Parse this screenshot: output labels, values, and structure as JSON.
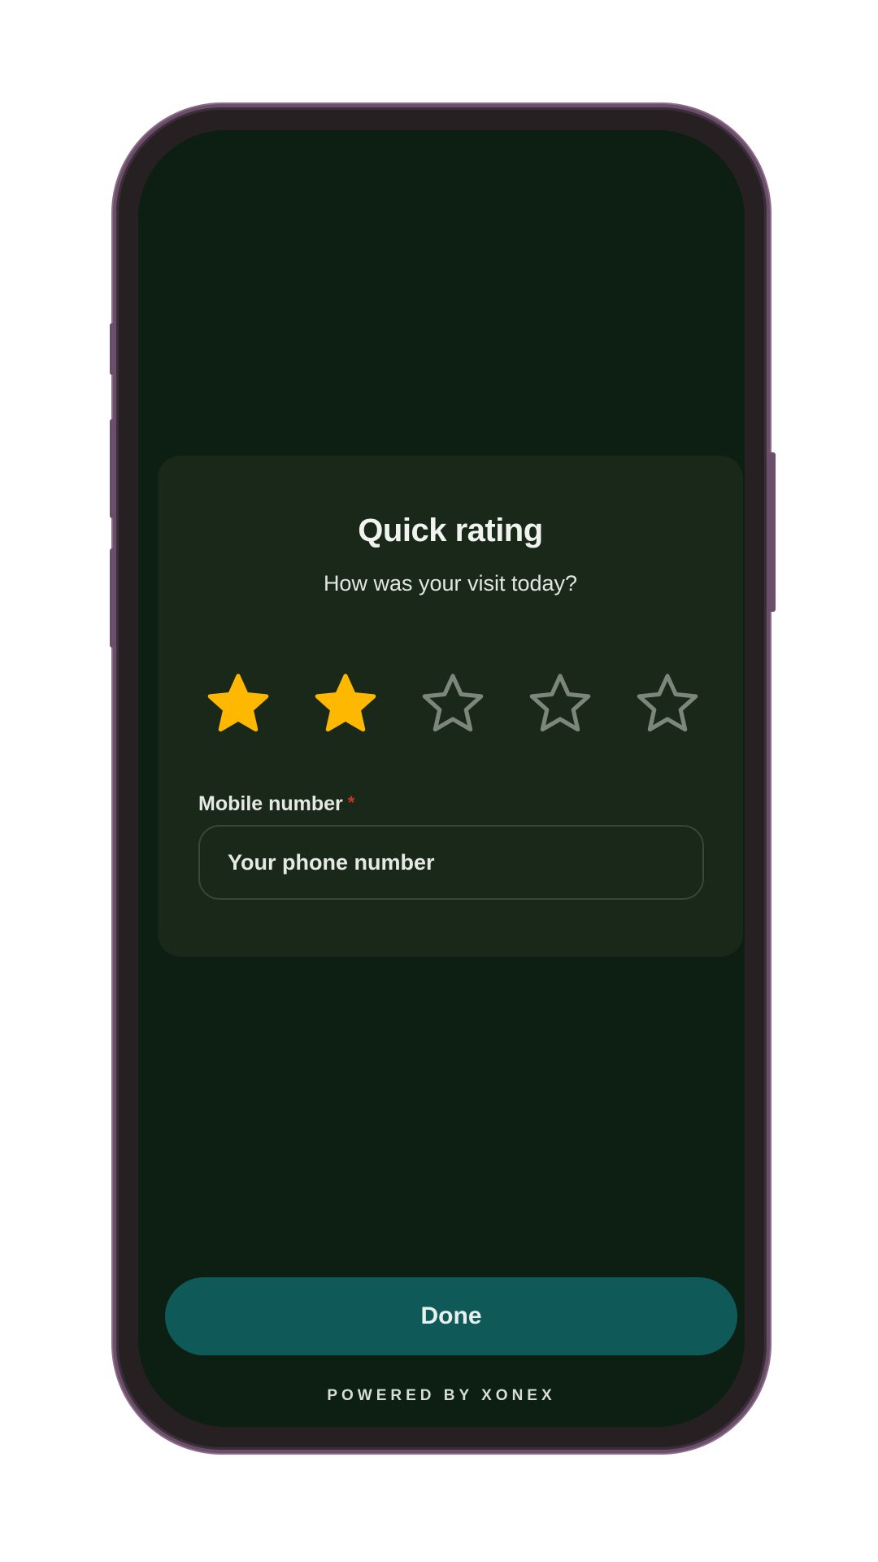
{
  "card": {
    "title": "Quick rating",
    "subtitle": "How was your visit today?"
  },
  "rating": {
    "value": 2,
    "max": 5,
    "filled_color": "#ffb800",
    "empty_color": "#7d867a",
    "stars": [
      {
        "icon": "star-filled-icon"
      },
      {
        "icon": "star-filled-icon"
      },
      {
        "icon": "star-outline-icon"
      },
      {
        "icon": "star-outline-icon"
      },
      {
        "icon": "star-outline-icon"
      }
    ]
  },
  "form": {
    "mobile_label": "Mobile number",
    "required_marker": "*",
    "phone_placeholder": "Your phone number",
    "phone_value": ""
  },
  "actions": {
    "done_label": "Done"
  },
  "footer": {
    "powered_by": "POWERED BY XONEX"
  },
  "colors": {
    "screen_bg": "#0c1f12",
    "card_bg": "#192818",
    "button_bg": "#0f5a58",
    "frame_accent": "#6b4e6a"
  }
}
